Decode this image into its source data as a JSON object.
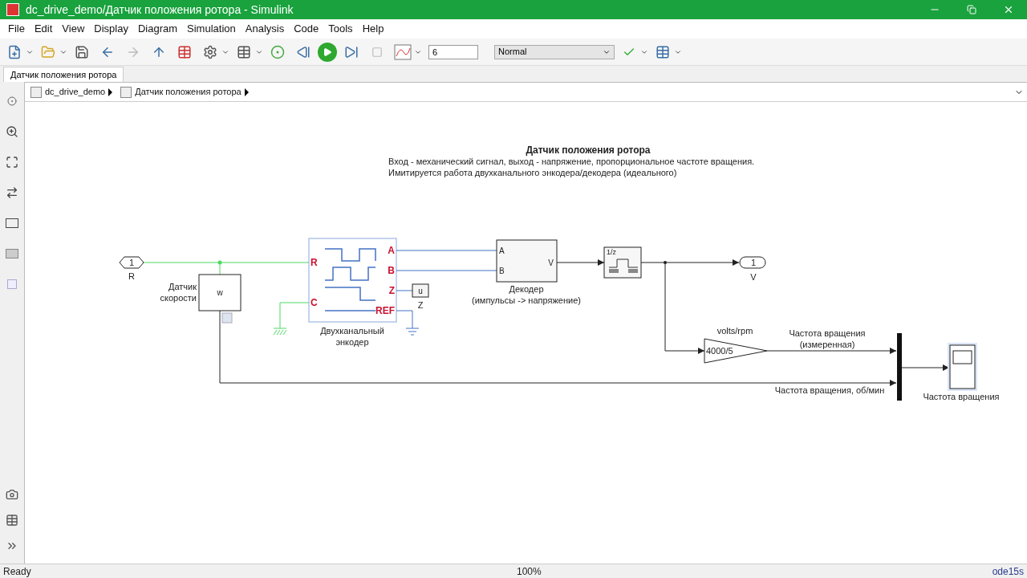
{
  "window": {
    "title": "dc_drive_demo/Датчик положения ротора - Simulink"
  },
  "menu": [
    "File",
    "Edit",
    "View",
    "Display",
    "Diagram",
    "Simulation",
    "Analysis",
    "Code",
    "Tools",
    "Help"
  ],
  "toolbar": {
    "stop_time": "6",
    "mode": "Normal"
  },
  "tabs": [
    {
      "label": "Датчик положения ротора",
      "selected": true
    }
  ],
  "breadcrumb": [
    "dc_drive_demo",
    "Датчик положения ротора"
  ],
  "diagram": {
    "annotation": {
      "title": "Датчик положения ротора",
      "lines": [
        "Вход - механический сигнал, выход - напряжение, пропорциональное частоте вращения.",
        "Имитируется работа двухканального энкодера/декодера (идеального)"
      ]
    },
    "inport": {
      "number": "1",
      "label": "R"
    },
    "speed_sensor": {
      "text": "w",
      "label": [
        "Датчик",
        "скорости"
      ]
    },
    "encoder": {
      "ports": {
        "R": "R",
        "C": "C",
        "A": "A",
        "B": "B",
        "Z": "Z",
        "REF": "REF"
      },
      "label": [
        "Двухканальный",
        "энкодер"
      ]
    },
    "z_block": {
      "text": "u",
      "label": "Z"
    },
    "decoder": {
      "ports": {
        "A": "A",
        "B": "B",
        "V": "V"
      },
      "label": [
        "Декодер",
        "(импульсы -> напряжение)"
      ]
    },
    "delay": {
      "text": "1/z"
    },
    "outport": {
      "number": "1",
      "label": "V"
    },
    "gain": {
      "text": "4000/5",
      "label": "volts/rpm"
    },
    "measured_label": [
      "Частота вращения",
      "(измеренная)"
    ],
    "rpm_label": "Частота вращения, об/мин",
    "scope": {
      "label": "Частота вращения",
      "selected": true
    }
  },
  "status_bar": {
    "state": "Ready",
    "zoom": "100%",
    "solver": "ode15s"
  }
}
